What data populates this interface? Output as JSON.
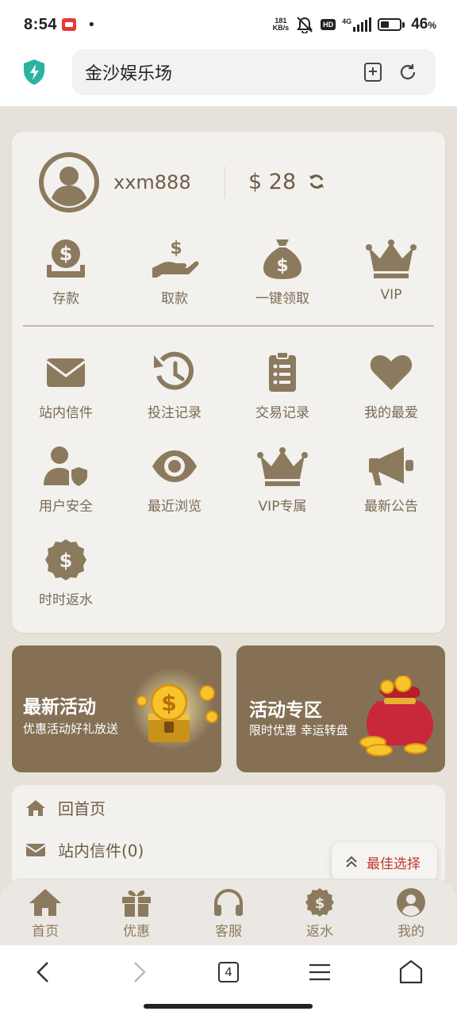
{
  "status_bar": {
    "time": "8:54",
    "dot": "•",
    "net_speed_value": "181",
    "net_speed_unit": "KB/s",
    "hd": "HD",
    "network": "4G",
    "battery_pct": "46",
    "battery_pct_symbol": "%",
    "battery_level": 0.46
  },
  "browser": {
    "page_title": "金沙娱乐场",
    "open_tabs": "4"
  },
  "account": {
    "username": "xxm888",
    "balance": "$ 28"
  },
  "quick_actions": [
    {
      "label": "存款",
      "icon": "deposit-icon"
    },
    {
      "label": "取款",
      "icon": "withdraw-icon"
    },
    {
      "label": "一键领取",
      "icon": "money-bag-icon"
    },
    {
      "label": "VIP",
      "icon": "crown-icon"
    }
  ],
  "features": [
    {
      "label": "站内信件",
      "icon": "envelope-icon"
    },
    {
      "label": "投注记录",
      "icon": "history-icon"
    },
    {
      "label": "交易记录",
      "icon": "clipboard-icon"
    },
    {
      "label": "我的最爱",
      "icon": "heart-icon"
    },
    {
      "label": "用户安全",
      "icon": "user-shield-icon"
    },
    {
      "label": "最近浏览",
      "icon": "eye-icon"
    },
    {
      "label": "VIP专属",
      "icon": "crown-icon"
    },
    {
      "label": "最新公告",
      "icon": "megaphone-icon"
    },
    {
      "label": "时时返水",
      "icon": "dollar-badge-icon"
    }
  ],
  "banners": [
    {
      "title": "最新活动",
      "subtitle": "优惠活动好礼放送"
    },
    {
      "title": "活动专区",
      "subtitle": "限时优惠 幸运转盘"
    }
  ],
  "menu": [
    {
      "label": "回首页",
      "icon": "home-icon"
    },
    {
      "label": "站内信件(0)",
      "icon": "envelope-icon"
    }
  ],
  "best_pick": "最佳选择",
  "tabs": [
    {
      "label": "首页",
      "icon": "home-icon"
    },
    {
      "label": "优惠",
      "icon": "gift-icon"
    },
    {
      "label": "客服",
      "icon": "headset-icon"
    },
    {
      "label": "返水",
      "icon": "dollar-badge-icon"
    },
    {
      "label": "我的",
      "icon": "user-circle-icon"
    }
  ],
  "colors": {
    "accent": "#857055",
    "icon": "#8b7a5e",
    "background": "#e6e2da",
    "card": "#f3f1ee",
    "best_pick_text": "#c0392b",
    "shield": "#2bb3a0"
  }
}
